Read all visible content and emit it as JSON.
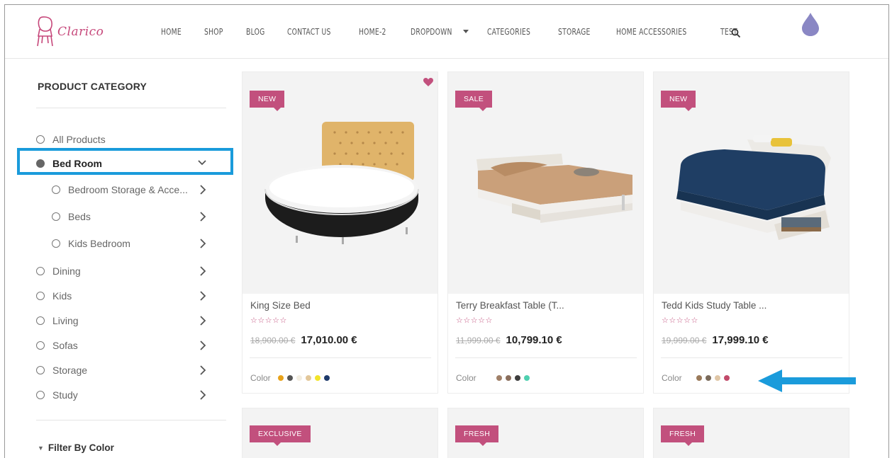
{
  "header": {
    "logo_text": "Clarico",
    "nav": [
      "HOME",
      "SHOP",
      "BLOG",
      "CONTACT US",
      "HOME-2",
      "DROPDOWN",
      "CATEGORIES",
      "STORAGE",
      "HOME ACCESSORIES",
      "TEST"
    ]
  },
  "sidebar": {
    "title": "PRODUCT CATEGORY",
    "items": [
      {
        "label": "All Products"
      },
      {
        "label": "Bed Room"
      },
      {
        "label": "Bedroom Storage & Acce..."
      },
      {
        "label": "Beds"
      },
      {
        "label": "Kids Bedroom"
      },
      {
        "label": "Dining"
      },
      {
        "label": "Kids"
      },
      {
        "label": "Living"
      },
      {
        "label": "Sofas"
      },
      {
        "label": "Storage"
      },
      {
        "label": "Study"
      }
    ],
    "filter_title": "Filter By Color"
  },
  "products": [
    {
      "badge": "NEW",
      "name": "King Size Bed",
      "stars": "☆☆☆☆☆",
      "old_price": "18,900.00 €",
      "price": "17,010.00 €",
      "color_label": "Color",
      "swatches": [
        "#e8a21a",
        "#555555",
        "#f3eee2",
        "#e3c79a",
        "#f2e42a",
        "#1e3a6b"
      ]
    },
    {
      "badge": "SALE",
      "name": "Terry Breakfast Table (T...",
      "stars": "☆☆☆☆☆",
      "old_price": "11,999.00 €",
      "price": "10,799.10 €",
      "color_label": "Color",
      "swatches": [
        "#a08068",
        "#8a6e5c",
        "#3d3d3d",
        "#4fd0b0"
      ]
    },
    {
      "badge": "NEW",
      "name": "Tedd Kids Study Table ...",
      "stars": "☆☆☆☆☆",
      "old_price": "19,999.00 €",
      "price": "17,999.10 €",
      "color_label": "Color",
      "swatches": [
        "#9a7a5a",
        "#7a6a5a",
        "#e0c6a6",
        "#c24a6a"
      ]
    }
  ],
  "products_row2": [
    {
      "badge": "EXCLUSIVE"
    },
    {
      "badge": "FRESH"
    },
    {
      "badge": "FRESH"
    }
  ]
}
